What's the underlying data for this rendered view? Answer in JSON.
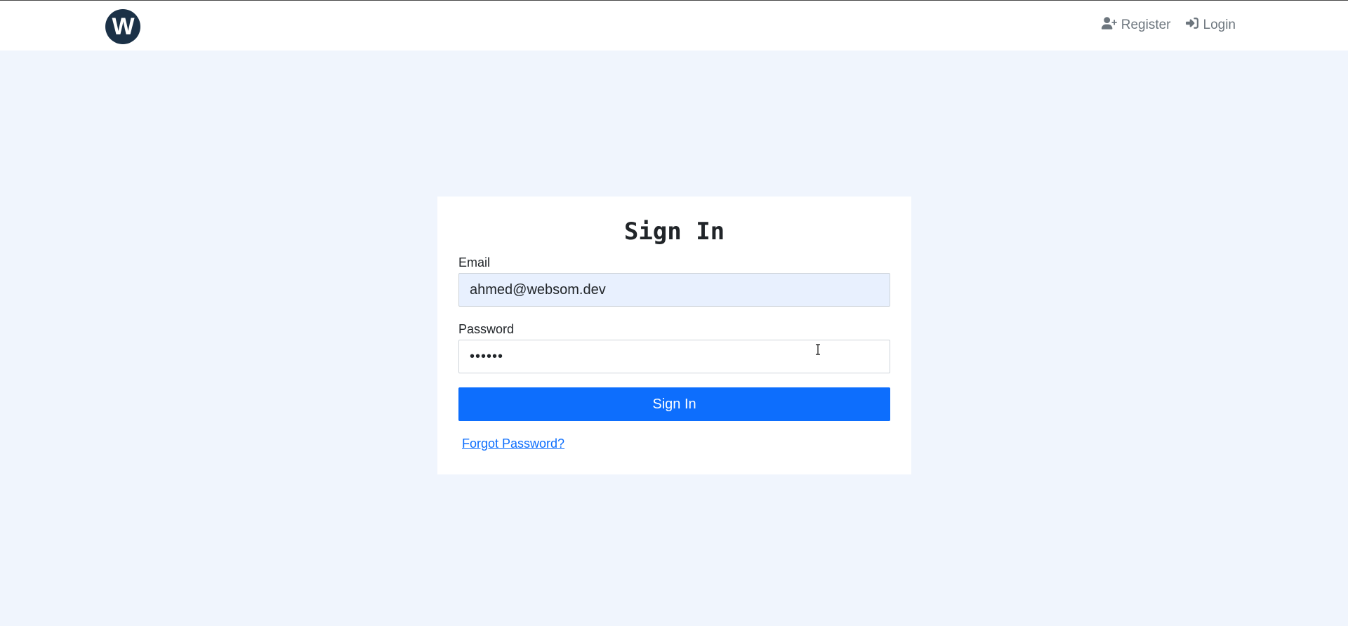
{
  "navbar": {
    "logo_text": "W",
    "links": [
      {
        "label": "Register",
        "icon": "user-plus-icon"
      },
      {
        "label": "Login",
        "icon": "sign-in-icon"
      }
    ]
  },
  "signin": {
    "title": "Sign In",
    "email_label": "Email",
    "email_value": "ahmed@websom.dev",
    "password_label": "Password",
    "password_value": "••••••",
    "submit_label": "Sign In",
    "forgot_label": "Forgot Password?"
  },
  "colors": {
    "page_bg": "#f0f5fd",
    "logo_bg": "#1b3147",
    "primary": "#0d6efd",
    "nav_text": "#6c757d",
    "autofill_bg": "#e8f0fe"
  }
}
